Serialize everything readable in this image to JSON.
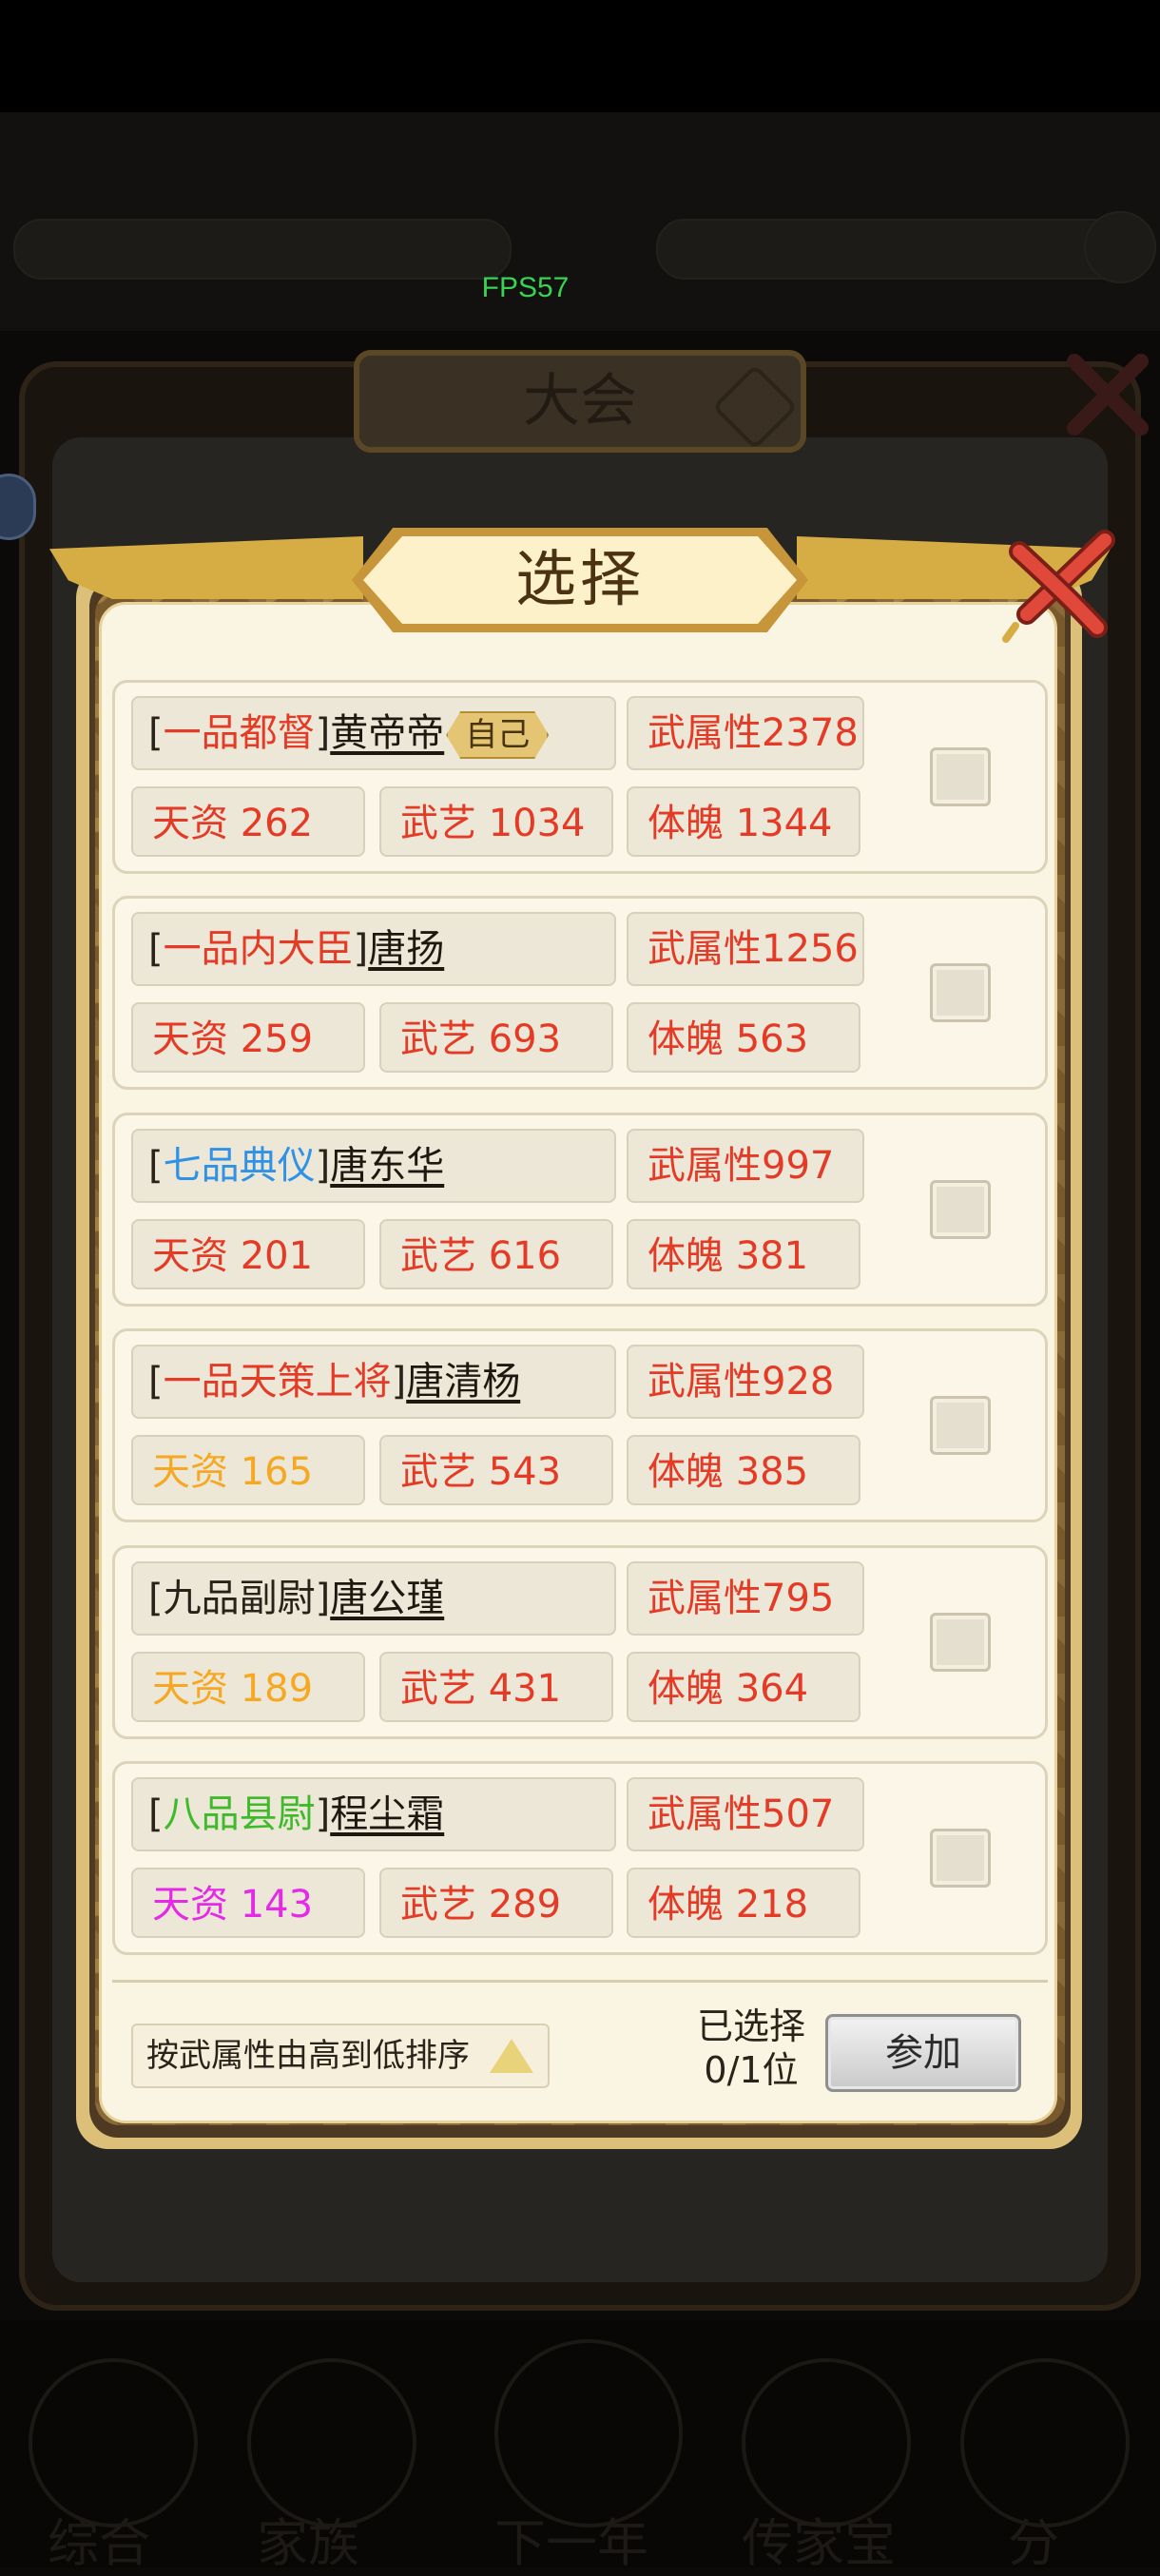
{
  "fps": "FPS57",
  "background_title": "大会",
  "dialog": {
    "title": "选择",
    "sort_label": "按武属性由高到低排序",
    "selected_line1": "已选择",
    "selected_line2": "0/1位",
    "join_label": "参加"
  },
  "colors": {
    "stat_red": "#e43a26",
    "stat_orange": "#f6a823",
    "stat_magenta": "#e629e6",
    "rank_red": "#e43a26",
    "rank_blue": "#2f92e6",
    "rank_green": "#3fba2a"
  },
  "candidates": [
    {
      "bracket_open": "[",
      "rank": "一品都督",
      "rank_color": "#e43a26",
      "bracket_close": "]",
      "name": "黄帝帝",
      "tag": "自己",
      "attr": "武属性2378",
      "talent": "天资 262",
      "talent_color": "#e43a26",
      "skill": "武艺 1034",
      "physique": "体魄 1344"
    },
    {
      "bracket_open": "[",
      "rank": "一品内大臣",
      "rank_color": "#e43a26",
      "bracket_close": "]",
      "name": "唐扬",
      "tag": "",
      "attr": "武属性1256",
      "talent": "天资 259",
      "talent_color": "#e43a26",
      "skill": "武艺 693",
      "physique": "体魄 563"
    },
    {
      "bracket_open": "[",
      "rank": "七品典仪",
      "rank_color": "#2f92e6",
      "bracket_close": "]",
      "name": "唐东华",
      "tag": "",
      "attr": "武属性997",
      "talent": "天资 201",
      "talent_color": "#e43a26",
      "skill": "武艺 616",
      "physique": "体魄 381"
    },
    {
      "bracket_open": "[",
      "rank": "一品天策上将",
      "rank_color": "#e43a26",
      "bracket_close": "]",
      "name": "唐清杨",
      "tag": "",
      "attr": "武属性928",
      "talent": "天资 165",
      "talent_color": "#f6a823",
      "skill": "武艺 543",
      "physique": "体魄 385"
    },
    {
      "bracket_open": "[",
      "rank": "九品副尉",
      "rank_color": "#2a2118",
      "bracket_close": "]",
      "name": "唐公瑾",
      "tag": "",
      "attr": "武属性795",
      "talent": "天资 189",
      "talent_color": "#f6a823",
      "skill": "武艺 431",
      "physique": "体魄 364"
    },
    {
      "bracket_open": "[",
      "rank": "八品县尉",
      "rank_color": "#3fba2a",
      "bracket_close": "]",
      "name": "程尘霜",
      "tag": "",
      "attr": "武属性507",
      "talent": "天资 143",
      "talent_color": "#e629e6",
      "skill": "武艺 289",
      "physique": "体魄 218"
    }
  ],
  "bottom_nav": [
    "综合",
    "家族",
    "下一年",
    "传家宝",
    "分"
  ]
}
